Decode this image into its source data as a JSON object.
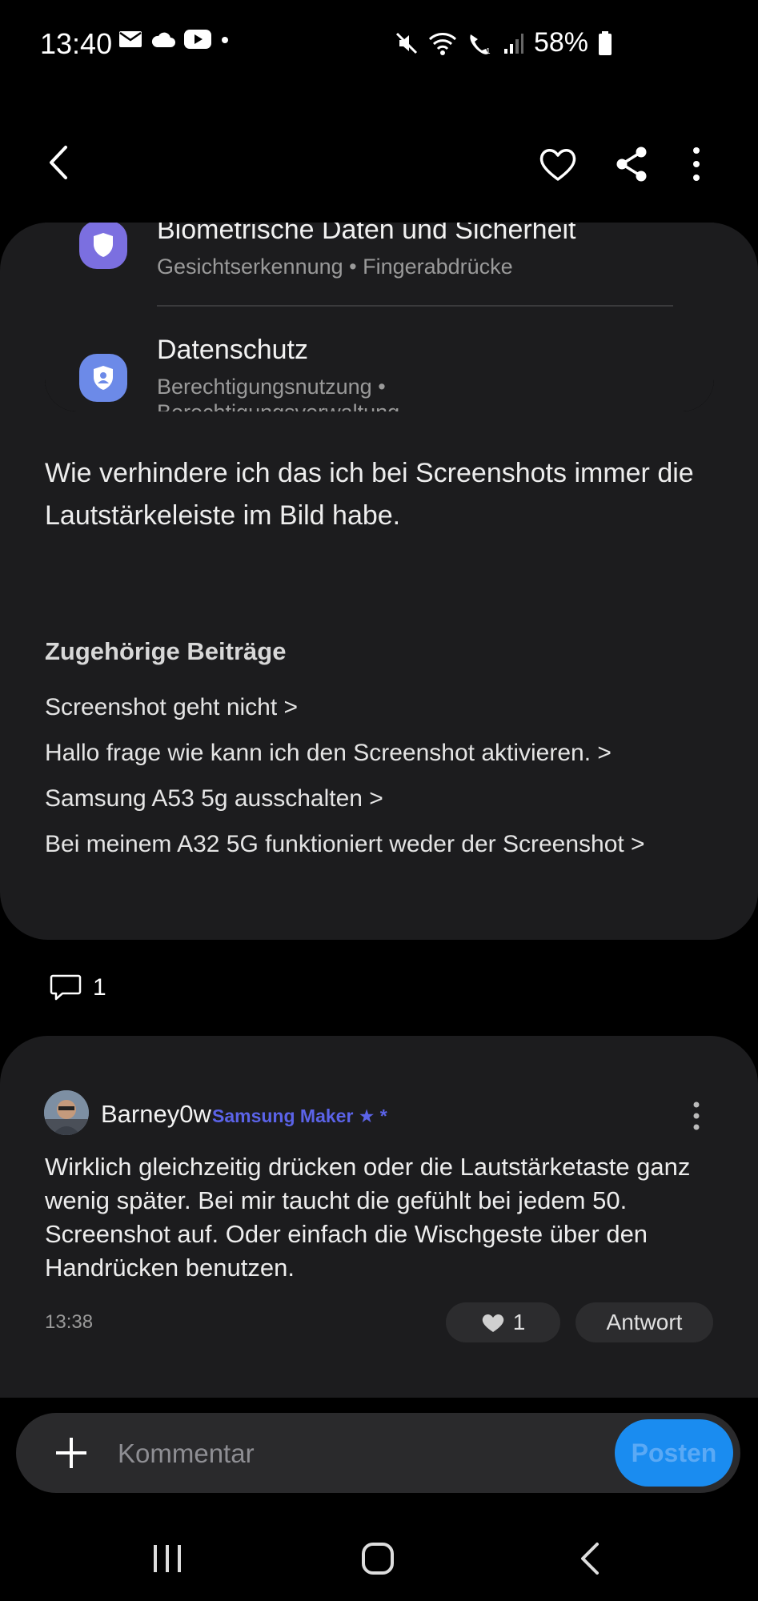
{
  "status_bar": {
    "time": "13:40",
    "battery": "58%",
    "left_icons": [
      "mail-icon",
      "cloud-icon",
      "youtube-icon",
      "dot-icon"
    ],
    "right_icons": [
      "mute-icon",
      "wifi-icon",
      "wifi-call-icon",
      "signal-icon",
      "battery-icon"
    ]
  },
  "app_bar": {
    "icons": [
      "back-icon",
      "heart-icon",
      "share-icon",
      "more-vertical-icon"
    ]
  },
  "embedded_settings": {
    "items": [
      {
        "title": "Biometrische Daten und Sicherheit",
        "subtitle": "Gesichtserkennung • Fingerabdrücke",
        "icon": "shield-icon",
        "icon_color": "#7b6fe0"
      },
      {
        "title": "Datenschutz",
        "subtitle": "Berechtigungsnutzung •",
        "subtitle2": "Berechtigungsverwaltung",
        "icon": "privacy-shield-icon",
        "icon_color": "#6c8ae8"
      }
    ]
  },
  "post": {
    "body": "Wie verhindere ich das ich bei Screenshots immer die Lautstärkeleiste im Bild habe.",
    "related_heading": "Zugehörige Beiträge",
    "related": [
      "Screenshot geht nicht >",
      "Hallo frage wie kann ich den Screenshot aktivieren. >",
      "Samsung A53 5g ausschalten >",
      "Bei meinem A32 5G funktioniert weder der Screenshot >"
    ],
    "comment_count": "1"
  },
  "reply": {
    "username": "Barney0w",
    "badge": "Samsung Maker ★ *",
    "text": "Wirklich gleichzeitig drücken oder die Lautstärketaste ganz wenig später. Bei mir taucht die gefühlt bei jedem 50. Screenshot auf. Oder einfach die Wischgeste über den Handrücken benutzen.",
    "time": "13:38",
    "likes": "1",
    "answer_label": "Antwort"
  },
  "comment_bar": {
    "placeholder": "Kommentar",
    "post_label": "Posten"
  },
  "colors": {
    "background": "#000000",
    "card": "#1c1c1e",
    "accent": "#1a8cf0",
    "badge": "#5b63e8"
  },
  "nav_bar": {
    "icons": [
      "recents-icon",
      "home-icon",
      "nav-back-icon"
    ]
  }
}
